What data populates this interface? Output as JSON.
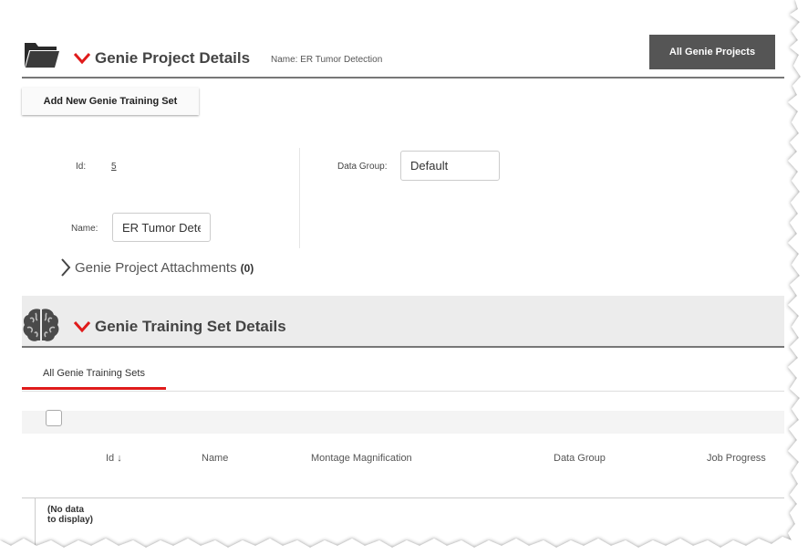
{
  "project": {
    "title": "Genie Project Details",
    "name_caption": "Name: ER Tumor Detection",
    "all_projects_button": "All Genie Projects",
    "add_training_set_button": "Add New Genie Training Set",
    "fields": {
      "id_label": "Id:",
      "id_value": "5",
      "name_label": "Name:",
      "name_value": "ER Tumor Dete",
      "data_group_label": "Data Group:",
      "data_group_value": "Default"
    },
    "attachments": {
      "label": "Genie Project Attachments",
      "count": "(0)"
    }
  },
  "training": {
    "title": "Genie Training Set Details",
    "tabs": [
      {
        "label": "All Genie Training Sets",
        "active": true
      }
    ],
    "columns": [
      "Id ↓",
      "Name",
      "Montage Magnification",
      "Data Group",
      "Job Progress"
    ],
    "empty_message": "(No data to display)"
  },
  "colors": {
    "accent": "#e01b1b",
    "header_button": "#555555",
    "section_bg": "#ececec"
  },
  "icons": [
    "folder-icon",
    "chevron-down-icon",
    "brain-icon",
    "chevron-right-icon"
  ]
}
